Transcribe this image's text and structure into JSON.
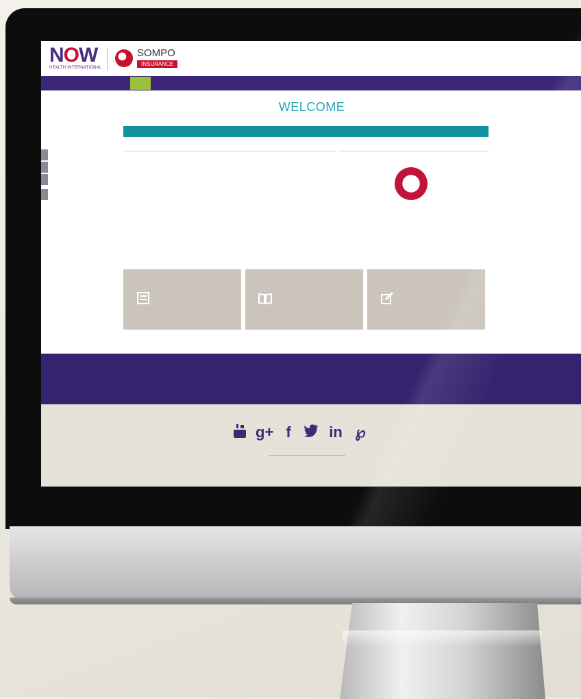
{
  "header": {
    "now_brand": "NOW",
    "now_tagline": "HEALTH INTERNATIONAL",
    "sompo_brand": "SOMPO",
    "sompo_tagline": "INSURANCE",
    "lang_label": "",
    "logout_label": ""
  },
  "nav": {
    "home": "",
    "items": [
      "",
      "",
      "",
      ""
    ]
  },
  "main": {
    "welcome": "WELCOME",
    "policy_label": "",
    "policy_value": "",
    "my_summary_title": "",
    "benefits_title": "",
    "summary_rows": [
      {
        "label": "",
        "value": ""
      },
      {
        "label": "",
        "value": ""
      },
      {
        "label": "",
        "value": ""
      },
      {
        "label": "",
        "value": ""
      }
    ],
    "more_content_title": ""
  },
  "tiles": [
    {
      "icon": "document-icon"
    },
    {
      "icon": "book-icon"
    },
    {
      "icon": "edit-icon"
    }
  ],
  "social": [
    {
      "icon": "youtube-icon",
      "glyph": "▣"
    },
    {
      "icon": "google-plus-icon",
      "glyph": "g+"
    },
    {
      "icon": "facebook-icon",
      "glyph": "f"
    },
    {
      "icon": "twitter-icon",
      "glyph": "✦"
    },
    {
      "icon": "linkedin-icon",
      "glyph": "in"
    },
    {
      "icon": "pinterest-icon",
      "glyph": "℘"
    }
  ],
  "colors": {
    "brand_purple": "#3b2679",
    "teal": "#16919f",
    "active_green": "#9bc13b",
    "brand_red": "#c8102e"
  }
}
